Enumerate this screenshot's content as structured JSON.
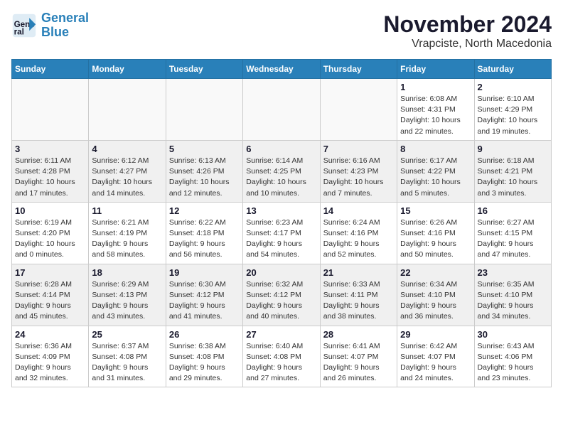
{
  "logo": {
    "line1": "General",
    "line2": "Blue"
  },
  "title": "November 2024",
  "subtitle": "Vrapciste, North Macedonia",
  "days_header": [
    "Sunday",
    "Monday",
    "Tuesday",
    "Wednesday",
    "Thursday",
    "Friday",
    "Saturday"
  ],
  "weeks": [
    [
      {
        "day": "",
        "info": ""
      },
      {
        "day": "",
        "info": ""
      },
      {
        "day": "",
        "info": ""
      },
      {
        "day": "",
        "info": ""
      },
      {
        "day": "",
        "info": ""
      },
      {
        "day": "1",
        "info": "Sunrise: 6:08 AM\nSunset: 4:31 PM\nDaylight: 10 hours\nand 22 minutes."
      },
      {
        "day": "2",
        "info": "Sunrise: 6:10 AM\nSunset: 4:29 PM\nDaylight: 10 hours\nand 19 minutes."
      }
    ],
    [
      {
        "day": "3",
        "info": "Sunrise: 6:11 AM\nSunset: 4:28 PM\nDaylight: 10 hours\nand 17 minutes."
      },
      {
        "day": "4",
        "info": "Sunrise: 6:12 AM\nSunset: 4:27 PM\nDaylight: 10 hours\nand 14 minutes."
      },
      {
        "day": "5",
        "info": "Sunrise: 6:13 AM\nSunset: 4:26 PM\nDaylight: 10 hours\nand 12 minutes."
      },
      {
        "day": "6",
        "info": "Sunrise: 6:14 AM\nSunset: 4:25 PM\nDaylight: 10 hours\nand 10 minutes."
      },
      {
        "day": "7",
        "info": "Sunrise: 6:16 AM\nSunset: 4:23 PM\nDaylight: 10 hours\nand 7 minutes."
      },
      {
        "day": "8",
        "info": "Sunrise: 6:17 AM\nSunset: 4:22 PM\nDaylight: 10 hours\nand 5 minutes."
      },
      {
        "day": "9",
        "info": "Sunrise: 6:18 AM\nSunset: 4:21 PM\nDaylight: 10 hours\nand 3 minutes."
      }
    ],
    [
      {
        "day": "10",
        "info": "Sunrise: 6:19 AM\nSunset: 4:20 PM\nDaylight: 10 hours\nand 0 minutes."
      },
      {
        "day": "11",
        "info": "Sunrise: 6:21 AM\nSunset: 4:19 PM\nDaylight: 9 hours\nand 58 minutes."
      },
      {
        "day": "12",
        "info": "Sunrise: 6:22 AM\nSunset: 4:18 PM\nDaylight: 9 hours\nand 56 minutes."
      },
      {
        "day": "13",
        "info": "Sunrise: 6:23 AM\nSunset: 4:17 PM\nDaylight: 9 hours\nand 54 minutes."
      },
      {
        "day": "14",
        "info": "Sunrise: 6:24 AM\nSunset: 4:16 PM\nDaylight: 9 hours\nand 52 minutes."
      },
      {
        "day": "15",
        "info": "Sunrise: 6:26 AM\nSunset: 4:16 PM\nDaylight: 9 hours\nand 50 minutes."
      },
      {
        "day": "16",
        "info": "Sunrise: 6:27 AM\nSunset: 4:15 PM\nDaylight: 9 hours\nand 47 minutes."
      }
    ],
    [
      {
        "day": "17",
        "info": "Sunrise: 6:28 AM\nSunset: 4:14 PM\nDaylight: 9 hours\nand 45 minutes."
      },
      {
        "day": "18",
        "info": "Sunrise: 6:29 AM\nSunset: 4:13 PM\nDaylight: 9 hours\nand 43 minutes."
      },
      {
        "day": "19",
        "info": "Sunrise: 6:30 AM\nSunset: 4:12 PM\nDaylight: 9 hours\nand 41 minutes."
      },
      {
        "day": "20",
        "info": "Sunrise: 6:32 AM\nSunset: 4:12 PM\nDaylight: 9 hours\nand 40 minutes."
      },
      {
        "day": "21",
        "info": "Sunrise: 6:33 AM\nSunset: 4:11 PM\nDaylight: 9 hours\nand 38 minutes."
      },
      {
        "day": "22",
        "info": "Sunrise: 6:34 AM\nSunset: 4:10 PM\nDaylight: 9 hours\nand 36 minutes."
      },
      {
        "day": "23",
        "info": "Sunrise: 6:35 AM\nSunset: 4:10 PM\nDaylight: 9 hours\nand 34 minutes."
      }
    ],
    [
      {
        "day": "24",
        "info": "Sunrise: 6:36 AM\nSunset: 4:09 PM\nDaylight: 9 hours\nand 32 minutes."
      },
      {
        "day": "25",
        "info": "Sunrise: 6:37 AM\nSunset: 4:08 PM\nDaylight: 9 hours\nand 31 minutes."
      },
      {
        "day": "26",
        "info": "Sunrise: 6:38 AM\nSunset: 4:08 PM\nDaylight: 9 hours\nand 29 minutes."
      },
      {
        "day": "27",
        "info": "Sunrise: 6:40 AM\nSunset: 4:08 PM\nDaylight: 9 hours\nand 27 minutes."
      },
      {
        "day": "28",
        "info": "Sunrise: 6:41 AM\nSunset: 4:07 PM\nDaylight: 9 hours\nand 26 minutes."
      },
      {
        "day": "29",
        "info": "Sunrise: 6:42 AM\nSunset: 4:07 PM\nDaylight: 9 hours\nand 24 minutes."
      },
      {
        "day": "30",
        "info": "Sunrise: 6:43 AM\nSunset: 4:06 PM\nDaylight: 9 hours\nand 23 minutes."
      }
    ]
  ]
}
